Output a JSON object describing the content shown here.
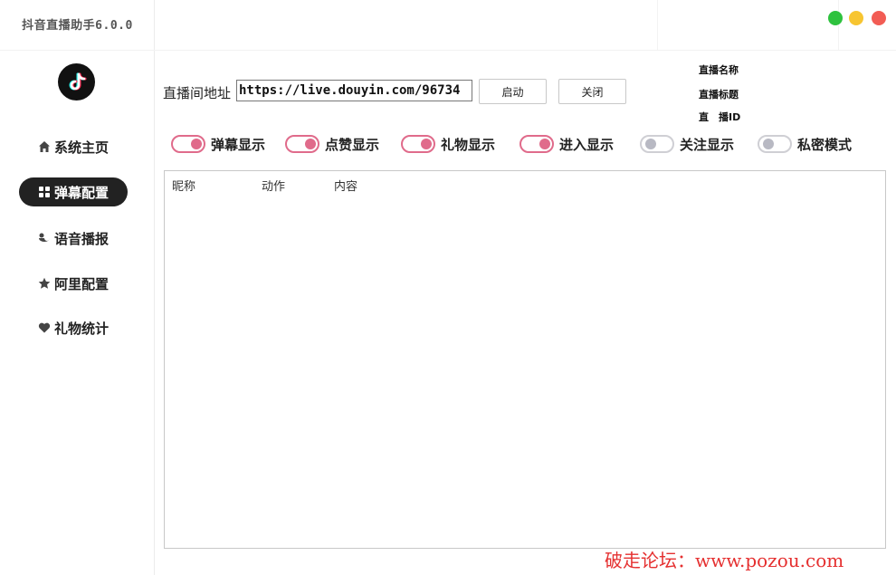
{
  "app": {
    "title": "抖音直播助手6.0.0"
  },
  "window_controls": {
    "green": "#2ec23e",
    "yellow": "#f7c531",
    "red": "#f25c54"
  },
  "sidebar": {
    "items": [
      {
        "label": "系统主页",
        "icon": "home-icon"
      },
      {
        "label": "弹幕配置",
        "icon": "grid-icon",
        "active": true
      },
      {
        "label": "语音播报",
        "icon": "voice-icon"
      },
      {
        "label": "阿里配置",
        "icon": "star-icon"
      },
      {
        "label": "礼物统计",
        "icon": "heart-icon"
      }
    ]
  },
  "url_bar": {
    "label": "直播间地址",
    "value": "https://live.douyin.com/96734",
    "start_label": "启动",
    "close_label": "关闭"
  },
  "info": {
    "name_label": "直播名称",
    "title_label": "直播标题",
    "id_label": "直　播ID"
  },
  "toggles": [
    {
      "label": "弹幕显示",
      "on": true
    },
    {
      "label": "点赞显示",
      "on": true
    },
    {
      "label": "礼物显示",
      "on": true
    },
    {
      "label": "进入显示",
      "on": true
    },
    {
      "label": "关注显示",
      "on": false
    },
    {
      "label": "私密模式",
      "on": false
    }
  ],
  "table": {
    "columns": [
      "昵称",
      "动作",
      "内容"
    ]
  },
  "watermark": "破走论坛：www.pozou.com",
  "colors": {
    "accent": "#e06b8b",
    "toggle_off": "#b8b9c3",
    "nav_active_bg": "#222222"
  }
}
